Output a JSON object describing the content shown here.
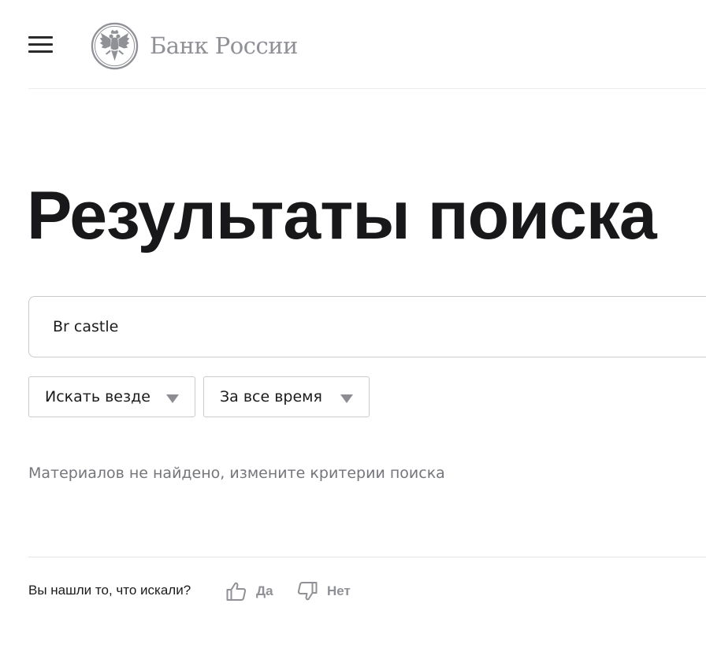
{
  "header": {
    "logo_text": "Банк России"
  },
  "page": {
    "title": "Результаты поиска"
  },
  "search": {
    "query": "Br castle"
  },
  "filters": {
    "scope": "Искать везде",
    "period": "За все время"
  },
  "results": {
    "empty_message": "Материалов не найдено, измените критерии поиска"
  },
  "feedback": {
    "question": "Вы нашли то, что искали?",
    "yes_label": "Да",
    "no_label": "Нет"
  },
  "colors": {
    "title": "#18181a",
    "muted": "#8f9196",
    "border": "#c9cacd",
    "empty_text": "#74767b"
  },
  "icons": {
    "menu": "menu-icon",
    "logo": "eagle-emblem-icon",
    "dropdown": "caret-down-icon",
    "yes": "thumbs-up-icon",
    "no": "thumbs-down-icon"
  }
}
